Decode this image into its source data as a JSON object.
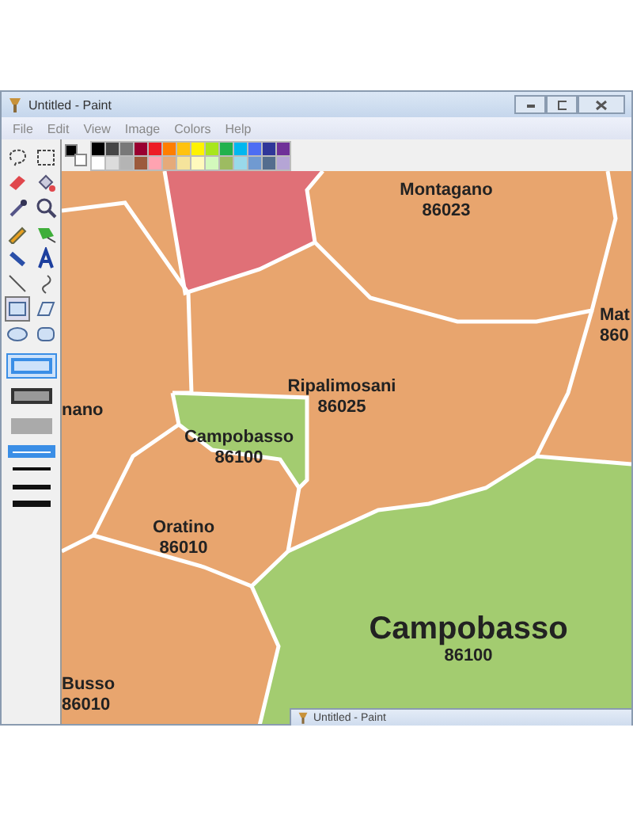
{
  "window": {
    "title": "Untitled - Paint"
  },
  "menu": [
    "File",
    "Edit",
    "View",
    "Image",
    "Colors",
    "Help"
  ],
  "current_colors": [
    {
      "color": "#000000"
    },
    {
      "color": "#ffffff"
    }
  ],
  "palette": {
    "colors": [
      {
        "color": "#000000"
      },
      {
        "color": "#464646"
      },
      {
        "color": "#787878"
      },
      {
        "color": "#990030"
      },
      {
        "color": "#ed1c24"
      },
      {
        "color": "#ff7e00"
      },
      {
        "color": "#ffc20e"
      },
      {
        "color": "#fff200"
      },
      {
        "color": "#a8e61d"
      },
      {
        "color": "#22b14c"
      },
      {
        "color": "#00b7ef"
      },
      {
        "color": "#4d6df3"
      },
      {
        "color": "#2f3699"
      },
      {
        "color": "#6f3198"
      },
      {
        "color": "#ffffff"
      },
      {
        "color": "#dcdcdc"
      },
      {
        "color": "#b4b4b4"
      },
      {
        "color": "#9c5a3c"
      },
      {
        "color": "#ffa3b1"
      },
      {
        "color": "#e5aa7a"
      },
      {
        "color": "#f5e49c"
      },
      {
        "color": "#fff9bd"
      },
      {
        "color": "#d3f9bc"
      },
      {
        "color": "#9dbb61"
      },
      {
        "color": "#99d9ea"
      },
      {
        "color": "#709ad1"
      },
      {
        "color": "#546d8e"
      },
      {
        "color": "#b5a5d5"
      }
    ]
  },
  "tools": [
    {
      "kind": "free-select",
      "selected": false
    },
    {
      "kind": "select",
      "selected": false
    },
    {
      "kind": "eraser",
      "selected": false
    },
    {
      "kind": "fill",
      "selected": false
    },
    {
      "kind": "picker",
      "selected": false
    },
    {
      "kind": "magnifier",
      "selected": false
    },
    {
      "kind": "pencil",
      "selected": false
    },
    {
      "kind": "brush",
      "selected": false
    },
    {
      "kind": "airbrush",
      "selected": false
    },
    {
      "kind": "text",
      "selected": false
    },
    {
      "kind": "line",
      "selected": false
    },
    {
      "kind": "curve",
      "selected": false
    },
    {
      "kind": "rectangle",
      "selected": true
    },
    {
      "kind": "polygon",
      "selected": false
    },
    {
      "kind": "ellipse",
      "selected": false
    },
    {
      "kind": "rounded-rectangle",
      "selected": false
    }
  ],
  "fill_styles": [
    {
      "kind": "outline",
      "selected": true
    },
    {
      "kind": "outline-fill",
      "selected": false
    },
    {
      "kind": "fill",
      "selected": false
    }
  ],
  "line_widths": [
    {
      "selected": true
    },
    {
      "selected": false
    },
    {
      "selected": false
    },
    {
      "selected": false
    }
  ],
  "map": {
    "labels": [
      {
        "name": "Montagano",
        "code": "86023",
        "kind": "small"
      },
      {
        "name": "Mat",
        "code": "860",
        "kind": "small"
      },
      {
        "name": "nano",
        "kind": "small"
      },
      {
        "name": "Ripalimosani",
        "code": "86025",
        "kind": "small"
      },
      {
        "name": "Campobasso",
        "code": "86100",
        "kind": "small"
      },
      {
        "name": "Oratino",
        "code": "86010",
        "kind": "small"
      },
      {
        "name": "Campobasso",
        "code": "86100",
        "kind": "large"
      },
      {
        "name": "Busso",
        "code": "86010",
        "kind": "small"
      }
    ]
  },
  "second_window": {
    "title": "Untitled - Paint"
  }
}
